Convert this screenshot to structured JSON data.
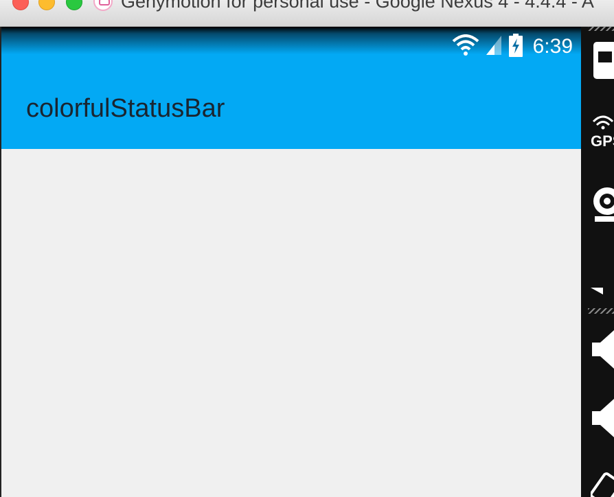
{
  "window": {
    "title": "Genymotion for personal use - Google Nexus 4 - 4.4.4 - A"
  },
  "device": {
    "status_bar": {
      "time": "6:39",
      "icons": [
        "wifi-icon",
        "cell-signal-icon",
        "battery-charging-icon"
      ]
    },
    "action_bar": {
      "title": "colorfulStatusBar"
    }
  },
  "toolbar": {
    "tools": [
      "battery-icon",
      "gps-icon",
      "webcam-icon",
      "volume-up-icon",
      "volume-down-icon",
      "rotate-icon"
    ],
    "gps_label": "GPS"
  },
  "colors": {
    "accent": "#03a9f4",
    "content_bg": "#f0f0f0",
    "title_text": "#1a2530"
  }
}
